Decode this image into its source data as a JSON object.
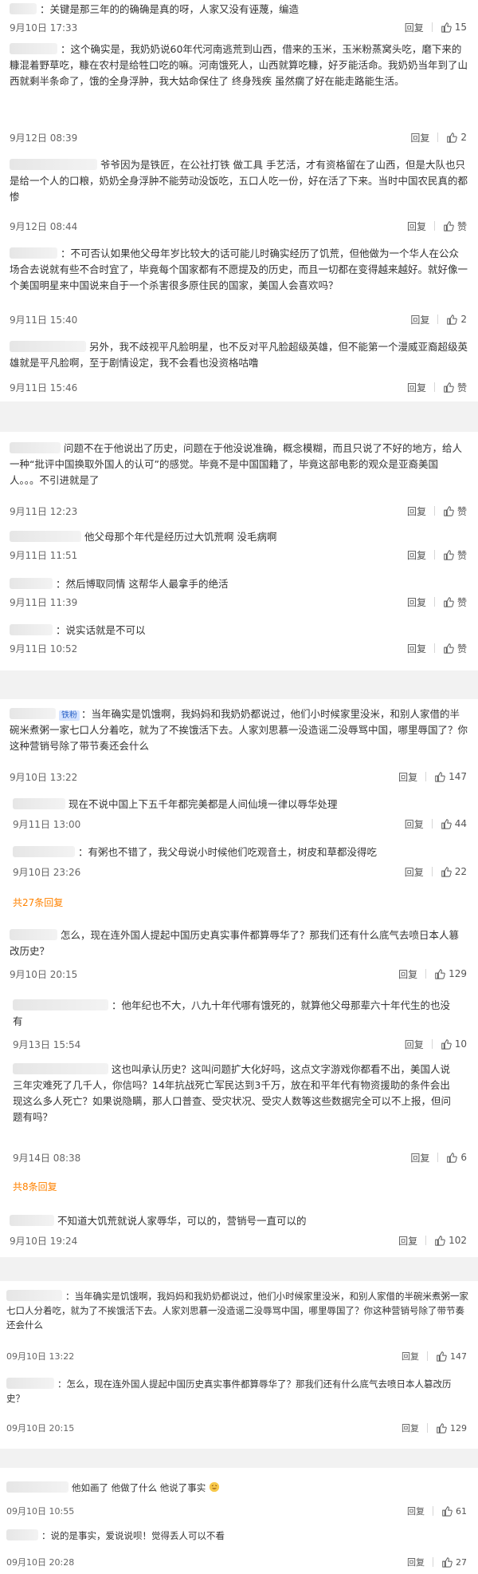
{
  "ui": {
    "reply_label": "回复",
    "like_label": "赞",
    "like_icon": "thumbs-up-icon",
    "accent_color": "#ff8200"
  },
  "comments": [
    {
      "text": "：关键是那三年的的确确是真的呀，人家又没有诬蔑，编造",
      "time": "9月10日 17:33",
      "likes": "15"
    },
    {
      "text": "：这个确实是，我奶奶说60年代河南逃荒到山西，借来的玉米，玉米粉蒸窝头吃，磨下来的糠混着野草吃，糠在农村是给牲口吃的嘛。河南饿死人，山西就算吃糠，好歹能活命。我奶奶当年到了山西就剩半条命了，饿的全身浮肿，我大姑命保住了 终身残疾 虽然瘸了好在能走路能生活。",
      "time": "9月12日 08:39",
      "likes": "2"
    },
    {
      "text": "爷爷因为是铁匠，在公社打铁 做工具 手艺活，才有资格留在了山西，但是大队也只是给一个人的口粮，奶奶全身浮肿不能劳动没饭吃，五口人吃一份，好在活了下来。当时中国农民真的都惨",
      "time": "9月12日 08:44",
      "likes": "赞"
    },
    {
      "text": "：不可否认如果他父母年岁比较大的话可能儿时确实经历了饥荒，但他做为一个华人在公众场合去说就有些不合时宜了，毕竟每个国家都有不愿提及的历史，而且一切都在变得越来越好。就好像一个美国明星来中国说来自于一个杀害很多原住民的国家，美国人会喜欢吗？",
      "time": "9月11日 15:40",
      "likes": "2"
    },
    {
      "text": "另外，我不歧视平凡脸明星，也不反对平凡脸超级英雄，但不能第一个漫威亚裔超级英雄就是平凡脸啊，至于剧情设定，我不会看也没资格咕噜",
      "time": "9月11日 15:46",
      "likes": "赞"
    },
    {
      "text": "问题不在于他说出了历史，问题在于他没说准确，概念模糊，而且只说了不好的地方，给人一种“批评中国换取外国人的认可”的感觉。毕竟不是中国国籍了，毕竟这部电影的观众是亚裔美国人。。。不引进就是了",
      "time": "9月11日 12:23",
      "likes": "赞"
    },
    {
      "text": "他父母那个年代是经历过大饥荒啊 没毛病啊",
      "time": "9月11日 11:51",
      "likes": "赞"
    },
    {
      "text": "：然后博取同情 这帮华人最拿手的绝活",
      "time": "9月11日 11:39",
      "likes": "赞"
    },
    {
      "text": "：说实话就是不可以",
      "time": "9月11日 10:52",
      "likes": "赞"
    },
    {
      "badge": "铁粉",
      "text": "：当年确实是饥饿啊，我妈妈和我奶奶都说过，他们小时候家里没米，和别人家借的半碗米煮粥一家七口人分着吃，就为了不挨饿活下去。人家刘思慕一没造谣二没辱骂中国，哪里辱国了？你这种营销号除了带节奏还会什么",
      "time": "9月10日 13:22",
      "likes": "147"
    },
    {
      "text": "现在不说中国上下五千年都完美都是人间仙境一律以辱华处理",
      "time": "9月11日 13:00",
      "likes": "44"
    },
    {
      "text": "：有粥也不错了，我父母说小时候他们吃观音土，树皮和草都没得吃",
      "time": "9月10日 23:26",
      "likes": "22"
    },
    {
      "more": "共27条回复"
    },
    {
      "text": "怎么，现在连外国人提起中国历史真实事件都算辱华了？那我们还有什么底气去喷日本人篡改历史？",
      "time": "9月10日 20:15",
      "likes": "129"
    },
    {
      "text": "：他年纪也不大，八九十年代哪有饿死的，就算他父母那辈六十年代生的也没有",
      "time": "9月13日 15:54",
      "likes": "10"
    },
    {
      "text": "这也叫承认历史？这叫问题扩大化好吗，这点文字游戏你都看不出，美国人说三年灾难死了几千人，你信吗？14年抗战死亡军民达到3千万，放在和平年代有物资援助的条件会出现这么多人死亡？如果说隐瞒，那人口普查、受灾状况、受灾人数等这些数据完全可以不上报，但问题有吗？",
      "time": "9月14日 08:38",
      "likes": "6"
    },
    {
      "more": "共8条回复"
    },
    {
      "text": "不知道大饥荒就说人家辱华，可以的，营销号一直可以的",
      "time": "9月10日 19:24",
      "likes": "102"
    },
    {
      "text": "：当年确实是饥饿啊，我妈妈和我奶奶都说过，他们小时候家里没米，和别人家借的半碗米煮粥一家七口人分着吃，就为了不挨饿活下去。人家刘思慕一没造谣二没辱骂中国，哪里辱国了？你这种营销号除了带节奏还会什么",
      "time": "09月10日 13:22",
      "likes": "147"
    },
    {
      "text": "：怎么，现在连外国人提起中国历史真实事件都算辱华了？那我们还有什么底气去喷日本人篡改历史？",
      "time": "09月10日 20:15",
      "likes": "129"
    },
    {
      "text": "他如画了 他做了什么 他说了事实",
      "time": "09月10日 10:55",
      "likes": "61"
    },
    {
      "text": "：说的是事实，爱说说呗！觉得丢人可以不看",
      "time": "09月10日 20:28",
      "likes": "27"
    }
  ]
}
